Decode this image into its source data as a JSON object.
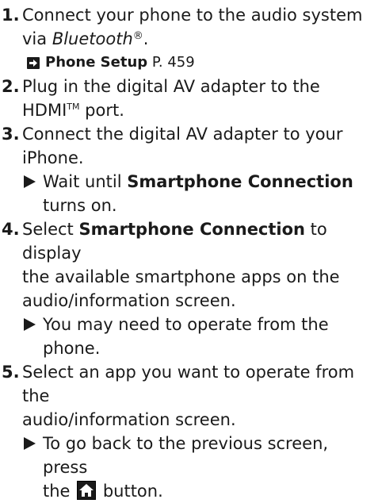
{
  "steps": [
    {
      "num": "1.",
      "line1": "Connect your phone to the audio system",
      "line2_pre": "via ",
      "line2_italic": "Bluetooth",
      "line2_reg": "®",
      "line2_post": ".",
      "xref": {
        "icon": "arrow-right-icon",
        "title": "Phone Setup",
        "page": " P. 459"
      }
    },
    {
      "num": "2.",
      "line1": "Plug in the digital AV adapter to the",
      "line2_pre": "HDMI",
      "line2_tm": "TM",
      "line2_post": " port."
    },
    {
      "num": "3.",
      "line1": "Connect the digital AV adapter to your",
      "line2": "iPhone.",
      "result": {
        "pre": "Wait until ",
        "bold": "Smartphone Connection",
        "line2": "turns on."
      }
    },
    {
      "num": "4.",
      "line1_pre": "Select ",
      "line1_bold": "Smartphone Connection",
      "line1_post": " to display",
      "line2": "the available smartphone apps on the",
      "line3": "audio/information screen.",
      "result": {
        "line1": "You may need to operate from the",
        "line2": "phone."
      }
    },
    {
      "num": "5.",
      "line1": "Select an app you want to operate from the",
      "line2": "audio/information screen.",
      "result": {
        "line1": "To go back to the previous screen, press",
        "line2_pre": "the ",
        "line2_icon": "home-icon",
        "line2_post": " button."
      }
    }
  ],
  "colors": {
    "text": "#1a1a1a",
    "background": "#ffffff"
  }
}
